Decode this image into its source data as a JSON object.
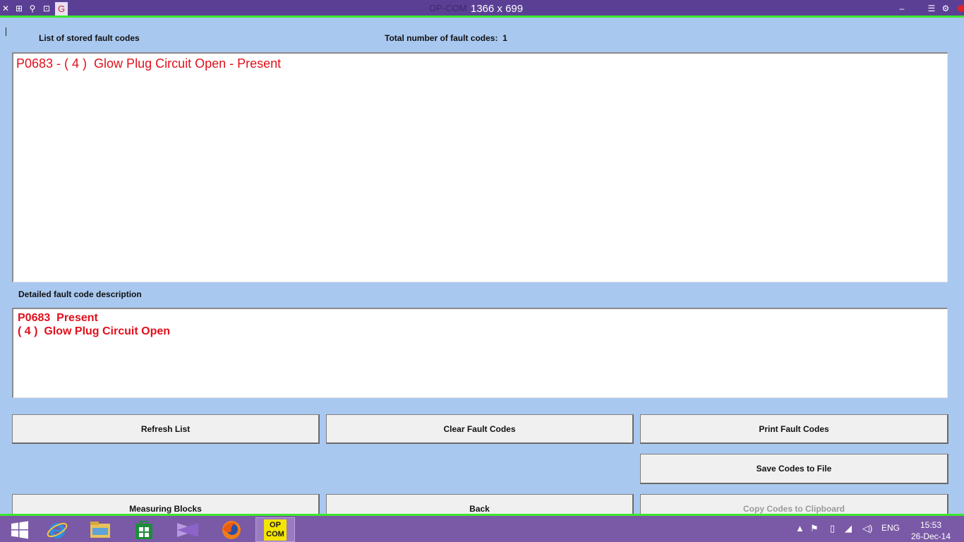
{
  "window": {
    "ghost_title": "OP-COM",
    "resolution_overlay": "1366 x 699",
    "app_letter": "G"
  },
  "labels": {
    "stored_list": "List of stored fault codes",
    "total_prefix": "Total number of fault codes:",
    "total_count": "1",
    "detail_heading": "Detailed fault code description"
  },
  "fault_list": [
    "P0683 - ( 4 )  Glow Plug Circuit Open - Present"
  ],
  "detail": {
    "line1": "P0683  Present",
    "line2": "( 4 )  Glow Plug Circuit Open"
  },
  "buttons": {
    "refresh": "Refresh List",
    "clear": "Clear Fault Codes",
    "print": "Print Fault Codes",
    "save": "Save Codes to File",
    "measuring": "Measuring Blocks",
    "back": "Back",
    "copy": "Copy Codes to Clipboard"
  },
  "taskbar": {
    "opcom_line1": "OP",
    "opcom_line2": "COM",
    "language": "ENG",
    "time": "15:53",
    "date": "26-Dec-14"
  }
}
